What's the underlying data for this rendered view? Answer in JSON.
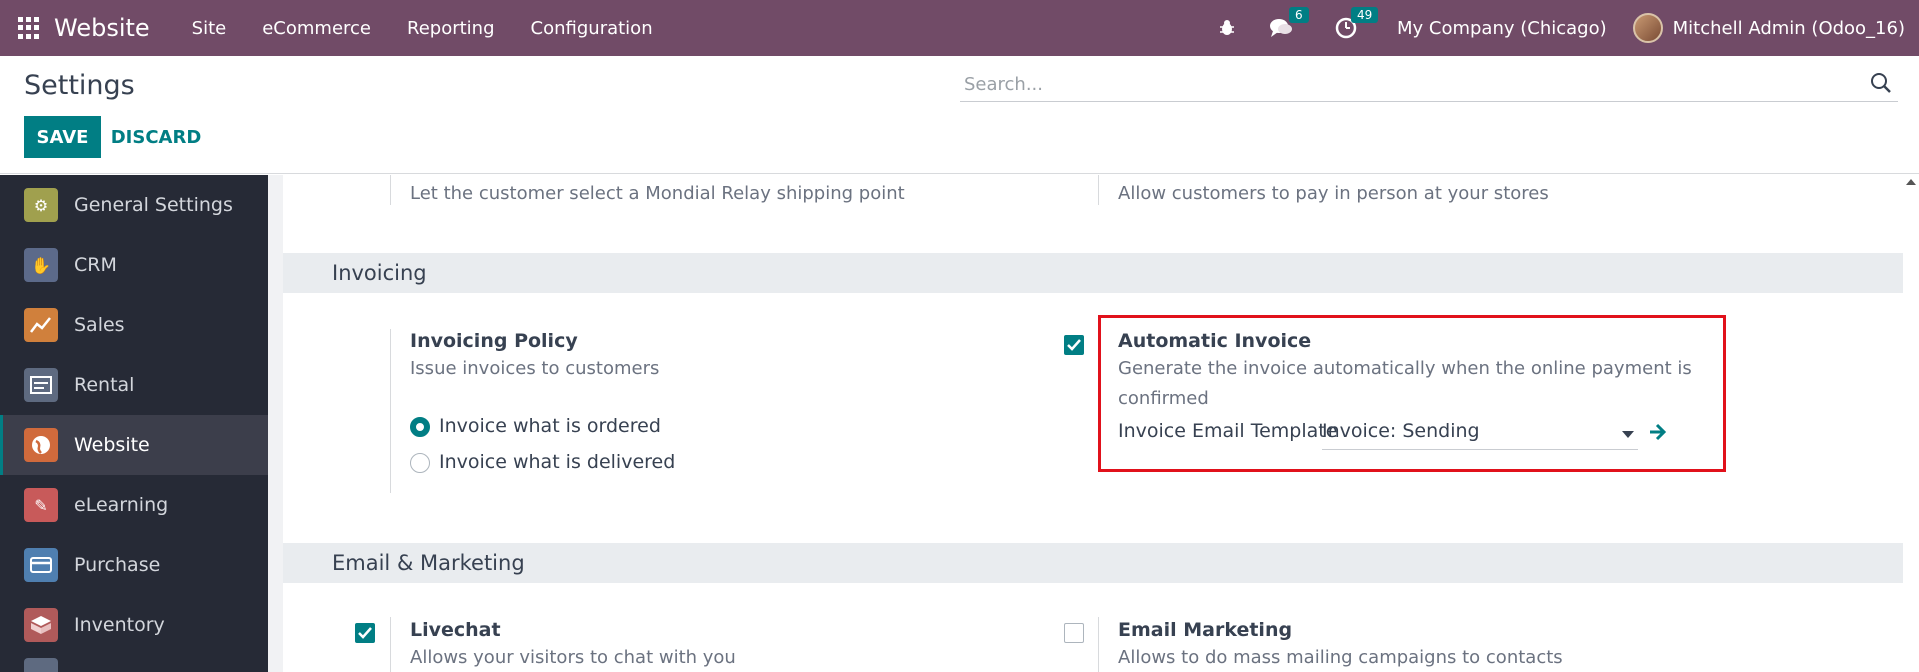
{
  "navbar": {
    "app_name": "Website",
    "menu": [
      "Site",
      "eCommerce",
      "Reporting",
      "Configuration"
    ],
    "messages_count": "6",
    "activities_count": "49",
    "company": "My Company (Chicago)",
    "user": "Mitchell Admin (Odoo_16)"
  },
  "control_panel": {
    "title": "Settings",
    "save_label": "SAVE",
    "discard_label": "DISCARD",
    "search_placeholder": "Search..."
  },
  "sidebar": {
    "items": [
      {
        "label": "General Settings",
        "icon": "gear-icon",
        "color": "#a0a04e"
      },
      {
        "label": "CRM",
        "icon": "handshake-icon",
        "color": "#5c6a8a"
      },
      {
        "label": "Sales",
        "icon": "chart-line-icon",
        "color": "#d0803c"
      },
      {
        "label": "Rental",
        "icon": "calendar-icon",
        "color": "#5e6a80"
      },
      {
        "label": "Website",
        "icon": "globe-icon",
        "color": "#d06a3c",
        "active": true
      },
      {
        "label": "eLearning",
        "icon": "elearning-icon",
        "color": "#c85a5a"
      },
      {
        "label": "Purchase",
        "icon": "card-icon",
        "color": "#4f7fb0"
      },
      {
        "label": "Inventory",
        "icon": "box-icon",
        "color": "#b05a5a"
      }
    ]
  },
  "content": {
    "top_row": {
      "left_desc": "Let the customer select a Mondial Relay shipping point",
      "right_desc": "Allow customers to pay in person at your stores"
    },
    "invoicing": {
      "section_title": "Invoicing",
      "policy": {
        "title": "Invoicing Policy",
        "desc": "Issue invoices to customers",
        "options": [
          {
            "label": "Invoice what is ordered",
            "selected": true
          },
          {
            "label": "Invoice what is delivered",
            "selected": false
          }
        ]
      },
      "auto_invoice": {
        "title": "Automatic Invoice",
        "checked": true,
        "desc_line1": "Generate the invoice automatically when the online payment is",
        "desc_line2": "confirmed",
        "template_label": "Invoice Email Template",
        "template_value": "Invoice: Sending"
      }
    },
    "email_marketing": {
      "section_title": "Email & Marketing",
      "livechat": {
        "title": "Livechat",
        "desc": "Allows your visitors to chat with you",
        "checked": true
      },
      "email_marketing": {
        "title": "Email Marketing",
        "desc": "Allows to do mass mailing campaigns to contacts",
        "checked": false
      }
    }
  }
}
